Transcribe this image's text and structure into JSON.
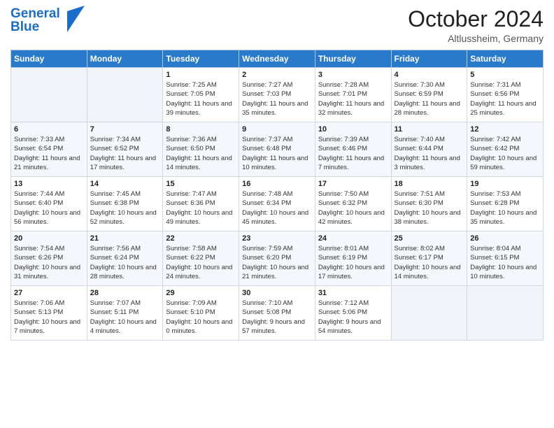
{
  "header": {
    "logo_line1": "General",
    "logo_line2": "Blue",
    "month": "October 2024",
    "location": "Altlussheim, Germany"
  },
  "weekdays": [
    "Sunday",
    "Monday",
    "Tuesday",
    "Wednesday",
    "Thursday",
    "Friday",
    "Saturday"
  ],
  "weeks": [
    [
      {
        "day": "",
        "info": ""
      },
      {
        "day": "",
        "info": ""
      },
      {
        "day": "1",
        "info": "Sunrise: 7:25 AM\nSunset: 7:05 PM\nDaylight: 11 hours and 39 minutes."
      },
      {
        "day": "2",
        "info": "Sunrise: 7:27 AM\nSunset: 7:03 PM\nDaylight: 11 hours and 35 minutes."
      },
      {
        "day": "3",
        "info": "Sunrise: 7:28 AM\nSunset: 7:01 PM\nDaylight: 11 hours and 32 minutes."
      },
      {
        "day": "4",
        "info": "Sunrise: 7:30 AM\nSunset: 6:59 PM\nDaylight: 11 hours and 28 minutes."
      },
      {
        "day": "5",
        "info": "Sunrise: 7:31 AM\nSunset: 6:56 PM\nDaylight: 11 hours and 25 minutes."
      }
    ],
    [
      {
        "day": "6",
        "info": "Sunrise: 7:33 AM\nSunset: 6:54 PM\nDaylight: 11 hours and 21 minutes."
      },
      {
        "day": "7",
        "info": "Sunrise: 7:34 AM\nSunset: 6:52 PM\nDaylight: 11 hours and 17 minutes."
      },
      {
        "day": "8",
        "info": "Sunrise: 7:36 AM\nSunset: 6:50 PM\nDaylight: 11 hours and 14 minutes."
      },
      {
        "day": "9",
        "info": "Sunrise: 7:37 AM\nSunset: 6:48 PM\nDaylight: 11 hours and 10 minutes."
      },
      {
        "day": "10",
        "info": "Sunrise: 7:39 AM\nSunset: 6:46 PM\nDaylight: 11 hours and 7 minutes."
      },
      {
        "day": "11",
        "info": "Sunrise: 7:40 AM\nSunset: 6:44 PM\nDaylight: 11 hours and 3 minutes."
      },
      {
        "day": "12",
        "info": "Sunrise: 7:42 AM\nSunset: 6:42 PM\nDaylight: 10 hours and 59 minutes."
      }
    ],
    [
      {
        "day": "13",
        "info": "Sunrise: 7:44 AM\nSunset: 6:40 PM\nDaylight: 10 hours and 56 minutes."
      },
      {
        "day": "14",
        "info": "Sunrise: 7:45 AM\nSunset: 6:38 PM\nDaylight: 10 hours and 52 minutes."
      },
      {
        "day": "15",
        "info": "Sunrise: 7:47 AM\nSunset: 6:36 PM\nDaylight: 10 hours and 49 minutes."
      },
      {
        "day": "16",
        "info": "Sunrise: 7:48 AM\nSunset: 6:34 PM\nDaylight: 10 hours and 45 minutes."
      },
      {
        "day": "17",
        "info": "Sunrise: 7:50 AM\nSunset: 6:32 PM\nDaylight: 10 hours and 42 minutes."
      },
      {
        "day": "18",
        "info": "Sunrise: 7:51 AM\nSunset: 6:30 PM\nDaylight: 10 hours and 38 minutes."
      },
      {
        "day": "19",
        "info": "Sunrise: 7:53 AM\nSunset: 6:28 PM\nDaylight: 10 hours and 35 minutes."
      }
    ],
    [
      {
        "day": "20",
        "info": "Sunrise: 7:54 AM\nSunset: 6:26 PM\nDaylight: 10 hours and 31 minutes."
      },
      {
        "day": "21",
        "info": "Sunrise: 7:56 AM\nSunset: 6:24 PM\nDaylight: 10 hours and 28 minutes."
      },
      {
        "day": "22",
        "info": "Sunrise: 7:58 AM\nSunset: 6:22 PM\nDaylight: 10 hours and 24 minutes."
      },
      {
        "day": "23",
        "info": "Sunrise: 7:59 AM\nSunset: 6:20 PM\nDaylight: 10 hours and 21 minutes."
      },
      {
        "day": "24",
        "info": "Sunrise: 8:01 AM\nSunset: 6:19 PM\nDaylight: 10 hours and 17 minutes."
      },
      {
        "day": "25",
        "info": "Sunrise: 8:02 AM\nSunset: 6:17 PM\nDaylight: 10 hours and 14 minutes."
      },
      {
        "day": "26",
        "info": "Sunrise: 8:04 AM\nSunset: 6:15 PM\nDaylight: 10 hours and 10 minutes."
      }
    ],
    [
      {
        "day": "27",
        "info": "Sunrise: 7:06 AM\nSunset: 5:13 PM\nDaylight: 10 hours and 7 minutes."
      },
      {
        "day": "28",
        "info": "Sunrise: 7:07 AM\nSunset: 5:11 PM\nDaylight: 10 hours and 4 minutes."
      },
      {
        "day": "29",
        "info": "Sunrise: 7:09 AM\nSunset: 5:10 PM\nDaylight: 10 hours and 0 minutes."
      },
      {
        "day": "30",
        "info": "Sunrise: 7:10 AM\nSunset: 5:08 PM\nDaylight: 9 hours and 57 minutes."
      },
      {
        "day": "31",
        "info": "Sunrise: 7:12 AM\nSunset: 5:06 PM\nDaylight: 9 hours and 54 minutes."
      },
      {
        "day": "",
        "info": ""
      },
      {
        "day": "",
        "info": ""
      }
    ]
  ]
}
